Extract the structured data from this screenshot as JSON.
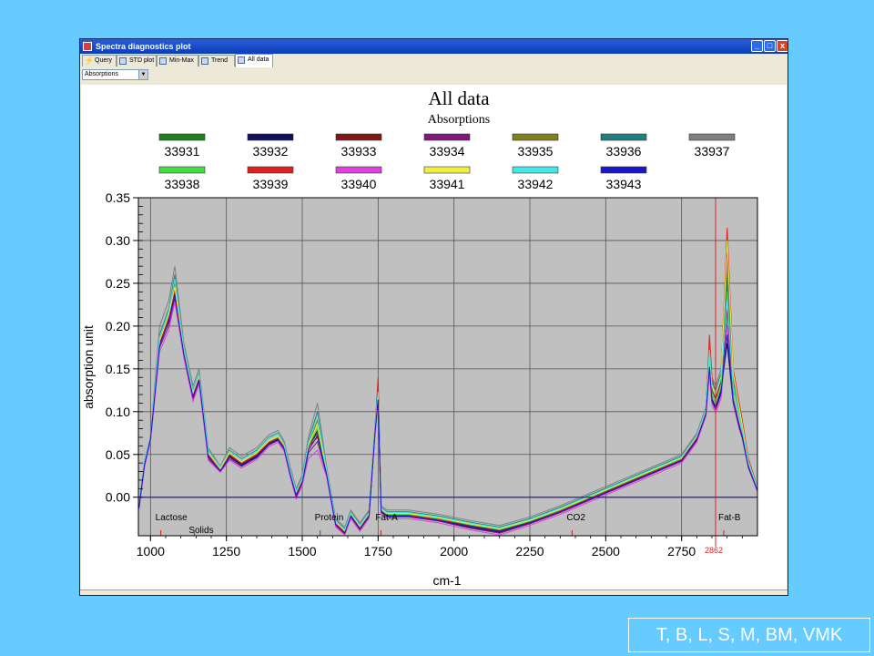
{
  "window": {
    "title": "Spectra diagnostics plot",
    "minimize_label": "_",
    "maximize_label": "□",
    "close_label": "x"
  },
  "tabs": [
    {
      "label": "Query",
      "active": false
    },
    {
      "label": "STD plot",
      "active": false
    },
    {
      "label": "Min-Max",
      "active": false
    },
    {
      "label": "Trend",
      "active": false
    },
    {
      "label": "All data",
      "active": true
    }
  ],
  "view_select": {
    "value": "Absorptions"
  },
  "chart_data": {
    "type": "line",
    "title": "All data",
    "subtitle": "Absorptions",
    "xlabel": "cm-1",
    "ylabel": "absorption unit",
    "xlim": [
      960,
      3000
    ],
    "ylim": [
      -0.045,
      0.35
    ],
    "x_ticks": [
      1000,
      1250,
      1500,
      1750,
      2000,
      2250,
      2500,
      2750
    ],
    "y_ticks": [
      0.0,
      0.05,
      0.1,
      0.15,
      0.2,
      0.25,
      0.3,
      0.35
    ],
    "y_tick_labels": [
      "0.00",
      "0.05",
      "0.10",
      "0.15",
      "0.20",
      "0.25",
      "0.30",
      "0.35"
    ],
    "x_tick_labels": [
      "1000",
      "1250",
      "1500",
      "1750",
      "2000",
      "2250",
      "2500",
      "2750"
    ],
    "grid": true,
    "legend_placement": "top",
    "baseline_color": "#2020C0",
    "marker_line": {
      "x": 2862,
      "label": "2862",
      "color": "#E02020"
    },
    "regions": [
      {
        "label": "Lactose",
        "x": 1010
      },
      {
        "label": "Solids",
        "x": 1120
      },
      {
        "label": "Protein",
        "x": 1535
      },
      {
        "label": "Fat-A",
        "x": 1735
      },
      {
        "label": "CO2",
        "x": 2365
      },
      {
        "label": "Fat-B",
        "x": 2865
      }
    ],
    "x": [
      962,
      980,
      1000,
      1030,
      1060,
      1080,
      1110,
      1140,
      1160,
      1190,
      1230,
      1260,
      1300,
      1350,
      1390,
      1420,
      1440,
      1460,
      1480,
      1500,
      1520,
      1550,
      1580,
      1610,
      1640,
      1660,
      1690,
      1720,
      1740,
      1750,
      1760,
      1780,
      1850,
      1950,
      2050,
      2150,
      2250,
      2350,
      2450,
      2550,
      2650,
      2750,
      2800,
      2830,
      2842,
      2850,
      2862,
      2880,
      2900,
      2920,
      2940,
      2950,
      2970,
      3000
    ],
    "series": [
      {
        "name": "33931",
        "color": "#208020",
        "values": [
          -0.01,
          0.04,
          0.07,
          0.18,
          0.21,
          0.24,
          0.17,
          0.12,
          0.14,
          0.05,
          0.03,
          0.05,
          0.04,
          0.05,
          0.065,
          0.07,
          0.06,
          0.03,
          0.005,
          0.02,
          0.06,
          0.085,
          0.03,
          -0.03,
          -0.04,
          -0.02,
          -0.035,
          -0.02,
          0.08,
          0.12,
          -0.015,
          -0.02,
          -0.02,
          -0.025,
          -0.032,
          -0.038,
          -0.028,
          -0.015,
          0.0,
          0.015,
          0.03,
          0.045,
          0.07,
          0.1,
          0.16,
          0.12,
          0.11,
          0.13,
          0.26,
          0.13,
          0.1,
          0.08,
          0.04,
          0.01
        ]
      },
      {
        "name": "33932",
        "color": "#101060",
        "values": [
          -0.012,
          0.038,
          0.068,
          0.178,
          0.205,
          0.238,
          0.168,
          0.118,
          0.138,
          0.048,
          0.032,
          0.048,
          0.038,
          0.048,
          0.063,
          0.068,
          0.058,
          0.028,
          0.003,
          0.018,
          0.058,
          0.078,
          0.028,
          -0.032,
          -0.042,
          -0.022,
          -0.037,
          -0.022,
          0.078,
          0.115,
          -0.017,
          -0.022,
          -0.022,
          -0.027,
          -0.035,
          -0.041,
          -0.03,
          -0.017,
          -0.002,
          0.013,
          0.028,
          0.043,
          0.068,
          0.098,
          0.155,
          0.115,
          0.105,
          0.125,
          0.18,
          0.11,
          0.08,
          0.07,
          0.035,
          0.008
        ]
      },
      {
        "name": "33933",
        "color": "#801818",
        "values": [
          -0.011,
          0.039,
          0.069,
          0.179,
          0.208,
          0.245,
          0.169,
          0.119,
          0.139,
          0.049,
          0.031,
          0.049,
          0.039,
          0.049,
          0.064,
          0.069,
          0.059,
          0.029,
          0.004,
          0.019,
          0.059,
          0.075,
          0.029,
          -0.031,
          -0.041,
          -0.021,
          -0.036,
          -0.021,
          0.079,
          0.118,
          -0.016,
          -0.021,
          -0.021,
          -0.026,
          -0.033,
          -0.039,
          -0.029,
          -0.016,
          -0.001,
          0.014,
          0.029,
          0.044,
          0.069,
          0.099,
          0.165,
          0.125,
          0.115,
          0.135,
          0.29,
          0.14,
          0.1,
          0.08,
          0.04,
          0.01
        ]
      },
      {
        "name": "33934",
        "color": "#801880",
        "values": [
          -0.013,
          0.036,
          0.066,
          0.175,
          0.2,
          0.232,
          0.165,
          0.115,
          0.135,
          0.045,
          0.03,
          0.045,
          0.036,
          0.046,
          0.061,
          0.066,
          0.056,
          0.026,
          0.0,
          0.016,
          0.052,
          0.065,
          0.026,
          -0.033,
          -0.043,
          -0.023,
          -0.038,
          -0.023,
          0.076,
          0.112,
          -0.018,
          -0.023,
          -0.023,
          -0.028,
          -0.036,
          -0.042,
          -0.031,
          -0.018,
          -0.003,
          0.012,
          0.027,
          0.042,
          0.066,
          0.096,
          0.15,
          0.112,
          0.102,
          0.12,
          0.22,
          0.115,
          0.085,
          0.072,
          0.036,
          0.008
        ]
      },
      {
        "name": "33935",
        "color": "#808020",
        "values": [
          -0.01,
          0.04,
          0.07,
          0.185,
          0.215,
          0.25,
          0.172,
          0.122,
          0.142,
          0.052,
          0.034,
          0.052,
          0.041,
          0.052,
          0.066,
          0.071,
          0.061,
          0.031,
          0.006,
          0.021,
          0.061,
          0.09,
          0.031,
          -0.029,
          -0.039,
          -0.019,
          -0.034,
          -0.019,
          0.081,
          0.122,
          -0.014,
          -0.019,
          -0.019,
          -0.024,
          -0.031,
          -0.037,
          -0.027,
          -0.014,
          0.001,
          0.016,
          0.031,
          0.046,
          0.071,
          0.101,
          0.17,
          0.13,
          0.12,
          0.14,
          0.28,
          0.14,
          0.1,
          0.08,
          0.04,
          0.01
        ]
      },
      {
        "name": "33936",
        "color": "#208080",
        "values": [
          -0.009,
          0.041,
          0.071,
          0.19,
          0.22,
          0.26,
          0.175,
          0.125,
          0.145,
          0.055,
          0.035,
          0.055,
          0.045,
          0.055,
          0.07,
          0.075,
          0.063,
          0.033,
          0.008,
          0.023,
          0.065,
          0.1,
          0.033,
          -0.027,
          -0.037,
          -0.017,
          -0.032,
          -0.017,
          0.083,
          0.125,
          -0.012,
          -0.017,
          -0.017,
          -0.022,
          -0.029,
          -0.035,
          -0.025,
          -0.012,
          0.003,
          0.018,
          0.033,
          0.048,
          0.073,
          0.103,
          0.175,
          0.135,
          0.125,
          0.145,
          0.25,
          0.135,
          0.1,
          0.082,
          0.042,
          0.011
        ]
      },
      {
        "name": "33937",
        "color": "#808080",
        "values": [
          -0.008,
          0.042,
          0.072,
          0.2,
          0.23,
          0.27,
          0.18,
          0.13,
          0.15,
          0.058,
          0.036,
          0.058,
          0.048,
          0.058,
          0.073,
          0.078,
          0.066,
          0.036,
          0.01,
          0.026,
          0.07,
          0.11,
          0.036,
          -0.025,
          -0.035,
          -0.015,
          -0.03,
          -0.015,
          0.086,
          0.13,
          -0.01,
          -0.015,
          -0.015,
          -0.02,
          -0.027,
          -0.033,
          -0.023,
          -0.01,
          0.005,
          0.02,
          0.035,
          0.05,
          0.075,
          0.105,
          0.18,
          0.14,
          0.13,
          0.15,
          0.27,
          0.14,
          0.105,
          0.085,
          0.045,
          0.012
        ]
      },
      {
        "name": "33938",
        "color": "#40E040",
        "values": [
          -0.01,
          0.04,
          0.07,
          0.182,
          0.212,
          0.243,
          0.171,
          0.121,
          0.141,
          0.051,
          0.033,
          0.051,
          0.04,
          0.051,
          0.065,
          0.07,
          0.06,
          0.03,
          0.005,
          0.02,
          0.06,
          0.08,
          0.03,
          -0.03,
          -0.04,
          -0.02,
          -0.035,
          -0.02,
          0.08,
          0.12,
          -0.015,
          -0.02,
          -0.02,
          -0.025,
          -0.032,
          -0.038,
          -0.028,
          -0.015,
          0.0,
          0.015,
          0.03,
          0.045,
          0.07,
          0.1,
          0.16,
          0.12,
          0.11,
          0.13,
          0.24,
          0.125,
          0.095,
          0.078,
          0.04,
          0.01
        ]
      },
      {
        "name": "33939",
        "color": "#E02020",
        "values": [
          -0.011,
          0.039,
          0.069,
          0.18,
          0.21,
          0.242,
          0.17,
          0.12,
          0.14,
          0.05,
          0.032,
          0.05,
          0.04,
          0.05,
          0.064,
          0.069,
          0.059,
          0.029,
          0.004,
          0.019,
          0.059,
          0.07,
          0.029,
          -0.031,
          -0.041,
          -0.021,
          -0.036,
          -0.021,
          0.079,
          0.14,
          -0.016,
          -0.021,
          -0.021,
          -0.026,
          -0.034,
          -0.04,
          -0.03,
          -0.016,
          -0.001,
          0.014,
          0.029,
          0.044,
          0.069,
          0.099,
          0.19,
          0.14,
          0.12,
          0.14,
          0.315,
          0.15,
          0.11,
          0.09,
          0.045,
          0.012
        ]
      },
      {
        "name": "33940",
        "color": "#E040E0",
        "values": [
          -0.014,
          0.035,
          0.065,
          0.17,
          0.195,
          0.228,
          0.162,
          0.112,
          0.132,
          0.043,
          0.029,
          0.043,
          0.034,
          0.044,
          0.059,
          0.064,
          0.054,
          0.024,
          -0.002,
          0.014,
          0.045,
          0.055,
          0.024,
          -0.035,
          -0.044,
          -0.025,
          -0.04,
          -0.025,
          0.074,
          0.11,
          -0.02,
          -0.025,
          -0.025,
          -0.03,
          -0.038,
          -0.044,
          -0.033,
          -0.02,
          -0.005,
          0.01,
          0.025,
          0.04,
          0.064,
          0.094,
          0.145,
          0.108,
          0.098,
          0.115,
          0.2,
          0.11,
          0.08,
          0.068,
          0.034,
          0.006
        ]
      },
      {
        "name": "33941",
        "color": "#F0F040",
        "values": [
          -0.01,
          0.04,
          0.07,
          0.183,
          0.213,
          0.246,
          0.172,
          0.122,
          0.142,
          0.052,
          0.033,
          0.052,
          0.041,
          0.052,
          0.066,
          0.071,
          0.061,
          0.031,
          0.006,
          0.021,
          0.061,
          0.085,
          0.031,
          -0.029,
          -0.039,
          -0.019,
          -0.034,
          -0.019,
          0.081,
          0.12,
          -0.014,
          -0.019,
          -0.019,
          -0.024,
          -0.031,
          -0.037,
          -0.027,
          -0.014,
          0.001,
          0.016,
          0.031,
          0.046,
          0.071,
          0.101,
          0.17,
          0.13,
          0.12,
          0.14,
          0.3,
          0.145,
          0.105,
          0.085,
          0.042,
          0.011
        ]
      },
      {
        "name": "33942",
        "color": "#40E8E8",
        "values": [
          -0.009,
          0.041,
          0.071,
          0.187,
          0.217,
          0.255,
          0.174,
          0.124,
          0.144,
          0.054,
          0.035,
          0.054,
          0.044,
          0.054,
          0.069,
          0.074,
          0.062,
          0.032,
          0.007,
          0.022,
          0.063,
          0.095,
          0.032,
          -0.028,
          -0.038,
          -0.018,
          -0.033,
          -0.018,
          0.082,
          0.123,
          -0.013,
          -0.018,
          -0.018,
          -0.023,
          -0.03,
          -0.036,
          -0.026,
          -0.013,
          0.002,
          0.017,
          0.032,
          0.047,
          0.072,
          0.102,
          0.172,
          0.132,
          0.122,
          0.142,
          0.23,
          0.13,
          0.098,
          0.08,
          0.041,
          0.011
        ]
      },
      {
        "name": "33943",
        "color": "#1818C8",
        "values": [
          -0.012,
          0.038,
          0.068,
          0.177,
          0.206,
          0.236,
          0.167,
          0.117,
          0.137,
          0.047,
          0.031,
          0.047,
          0.037,
          0.047,
          0.062,
          0.067,
          0.057,
          0.027,
          0.002,
          0.017,
          0.055,
          0.072,
          0.027,
          -0.032,
          -0.042,
          -0.022,
          -0.037,
          -0.022,
          0.077,
          0.114,
          -0.017,
          -0.022,
          -0.022,
          -0.027,
          -0.034,
          -0.04,
          -0.03,
          -0.017,
          -0.002,
          0.013,
          0.028,
          0.043,
          0.067,
          0.097,
          0.152,
          0.113,
          0.103,
          0.122,
          0.19,
          0.112,
          0.082,
          0.07,
          0.035,
          0.008
        ]
      }
    ]
  },
  "credit": {
    "text": "T, B, L, S, M, BM, VMK"
  }
}
